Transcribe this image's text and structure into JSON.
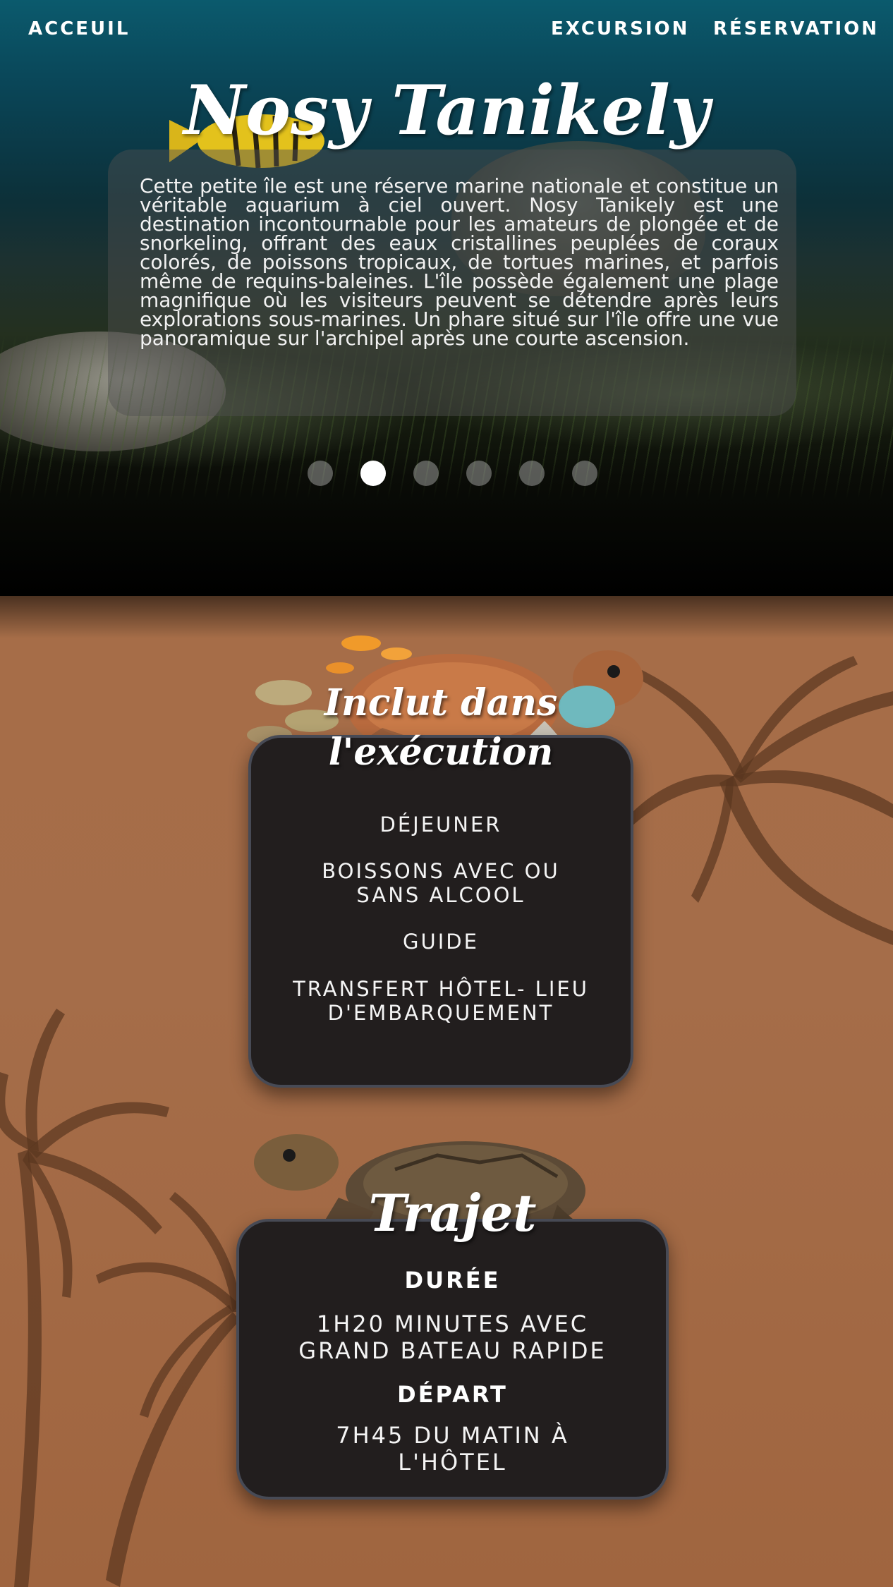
{
  "nav": {
    "home": "ACCEUIL",
    "excursion": "EXCURSION",
    "reservation": "RÉSERVATION"
  },
  "hero": {
    "title": "Nosy Tanikely",
    "description": "Cette petite île est une réserve marine nationale et constitue un véritable aquarium à ciel ouvert. Nosy Tanikely est une destination incontournable pour les amateurs de plongée et de snorkeling, offrant des eaux cristallines peuplées de coraux colorés, de poissons tropicaux, de tortues marines, et parfois même de requins-baleines. L'île possède également une plage magnifique où les visiteurs peuvent se détendre après leurs explorations sous-marines. Un phare situé sur l'île offre une vue panoramique sur l'archipel après une courte ascension.",
    "slides_total": 6,
    "active_slide": 2
  },
  "included": {
    "title_line1": "Inclut dans",
    "title_line2": "l'exécution",
    "items": [
      "DÉJEUNER",
      "BOISSONS AVEC OU\nSANS ALCOOL",
      "GUIDE",
      "TRANSFERT HÔTEL- LIEU\nD'EMBARQUEMENT"
    ]
  },
  "trip": {
    "title": "Trajet",
    "duration_label": "DURÉE",
    "duration_value": "1H20 MINUTES AVEC\nGRAND BATEAU RAPIDE",
    "departure_label": "DÉPART",
    "departure_value": "7H45 DU MATIN À\nL'HÔTEL"
  },
  "colors": {
    "hero_top": "#0b5a6d",
    "section_bg": "#a66d48",
    "card_bg": "#221e1e",
    "card_border": "#474a55",
    "palm": "#5a3620"
  }
}
